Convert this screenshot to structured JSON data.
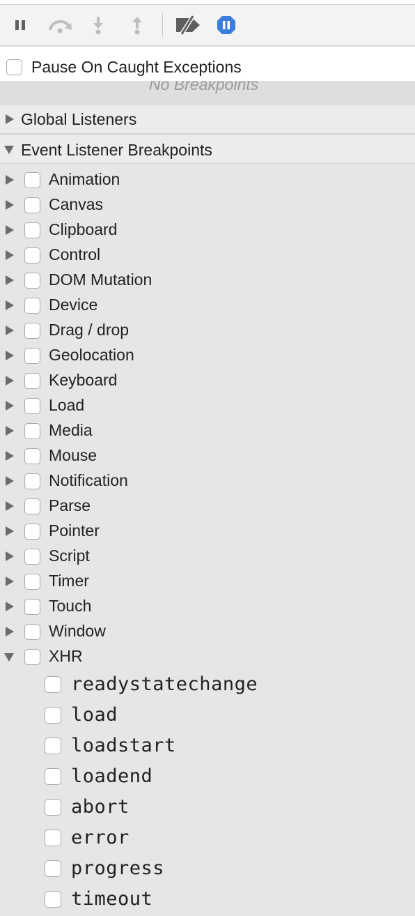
{
  "toolbar": {
    "buttons": [
      {
        "name": "pause-icon"
      },
      {
        "name": "step-over-icon"
      },
      {
        "name": "step-into-icon"
      },
      {
        "name": "step-out-icon"
      },
      {
        "name": "deactivate-breakpoints-icon"
      },
      {
        "name": "pause-on-exceptions-icon",
        "active_color": "#3b7ddd"
      }
    ]
  },
  "pause_on_caught": {
    "label": "Pause On Caught Exceptions",
    "checked": false
  },
  "breakpoints": {
    "empty_text": "No Breakpoints"
  },
  "sections": {
    "global_listeners": {
      "label": "Global Listeners",
      "expanded": false
    },
    "event_listener_breakpoints": {
      "label": "Event Listener Breakpoints",
      "expanded": true
    }
  },
  "categories": [
    {
      "label": "Animation",
      "expanded": false
    },
    {
      "label": "Canvas",
      "expanded": false
    },
    {
      "label": "Clipboard",
      "expanded": false
    },
    {
      "label": "Control",
      "expanded": false
    },
    {
      "label": "DOM Mutation",
      "expanded": false
    },
    {
      "label": "Device",
      "expanded": false
    },
    {
      "label": "Drag / drop",
      "expanded": false
    },
    {
      "label": "Geolocation",
      "expanded": false
    },
    {
      "label": "Keyboard",
      "expanded": false
    },
    {
      "label": "Load",
      "expanded": false
    },
    {
      "label": "Media",
      "expanded": false
    },
    {
      "label": "Mouse",
      "expanded": false
    },
    {
      "label": "Notification",
      "expanded": false
    },
    {
      "label": "Parse",
      "expanded": false
    },
    {
      "label": "Pointer",
      "expanded": false
    },
    {
      "label": "Script",
      "expanded": false
    },
    {
      "label": "Timer",
      "expanded": false
    },
    {
      "label": "Touch",
      "expanded": false
    },
    {
      "label": "Window",
      "expanded": false
    },
    {
      "label": "XHR",
      "expanded": true
    }
  ],
  "xhr_events": [
    "readystatechange",
    "load",
    "loadstart",
    "loadend",
    "abort",
    "error",
    "progress",
    "timeout"
  ]
}
